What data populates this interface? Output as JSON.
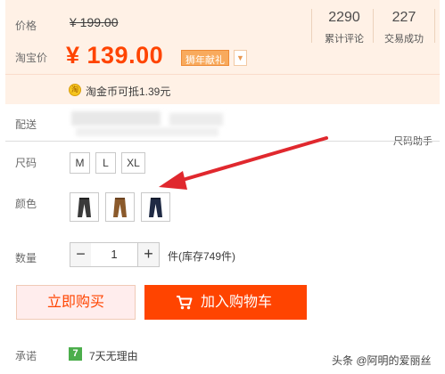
{
  "price": {
    "original_label": "价格",
    "original_price": "¥ 199.00",
    "current_label": "淘宝价",
    "current_price": "¥ 139.00",
    "promo_tag": "狮年献礼",
    "promo_dropdown_icon": "chevron-down-icon"
  },
  "stats": {
    "reviews_count": "2290",
    "reviews_label": "累计评论",
    "sales_count": "227",
    "sales_label": "交易成功"
  },
  "coin": {
    "icon_text": "淘",
    "text": "淘金币可抵1.39元"
  },
  "shipping": {
    "label": "配送"
  },
  "size_helper": "尺码助手",
  "size": {
    "label": "尺码",
    "options": [
      "M",
      "L",
      "XL"
    ]
  },
  "color": {
    "label": "颜色",
    "swatches": [
      "pants-black-swatch",
      "pants-brown-swatch",
      "pants-navy-swatch"
    ],
    "swatch_colors": [
      "#3a3a3a",
      "#8b5a2b",
      "#1f2a44"
    ]
  },
  "quantity": {
    "label": "数量",
    "minus": "−",
    "value": "1",
    "plus": "+",
    "stock_text": "件(库存749件)"
  },
  "actions": {
    "buy_now": "立即购买",
    "add_to_cart": "加入购物车",
    "accent_color": "#ff4400"
  },
  "promise": {
    "label": "承诺",
    "icon_text": "7",
    "text": "7天无理由"
  },
  "watermark": "头条 @阿明的爱丽丝"
}
